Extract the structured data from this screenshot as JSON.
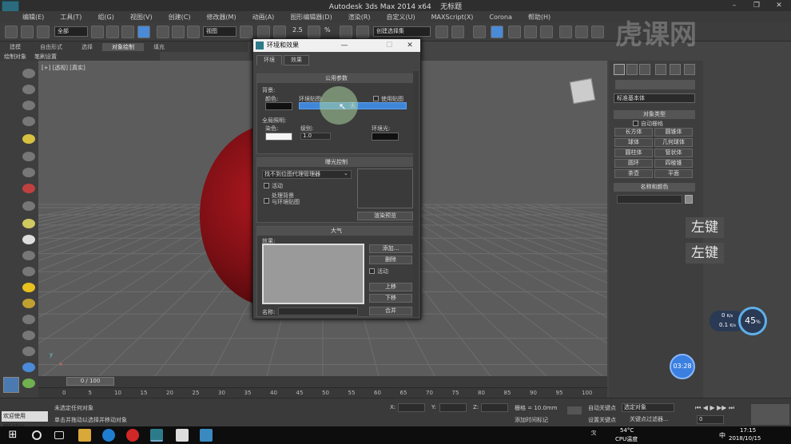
{
  "title_bar": {
    "app": "Autodesk 3ds Max  2014 x64",
    "doc": "无标题",
    "minimize": "–",
    "maximize": "❐",
    "close": "✕"
  },
  "menu": [
    "编辑(E)",
    "工具(T)",
    "组(G)",
    "视图(V)",
    "创建(C)",
    "修改器(M)",
    "动画(A)",
    "图形编辑器(D)",
    "渲染(R)",
    "自定义(U)",
    "MAXScript(X)",
    "Corona",
    "帮助(H)"
  ],
  "toolbar": {
    "selection_filter": "全部",
    "ref_coord": "视图",
    "named_sel": "创建选择集",
    "snap_label": "2.5",
    "percent_label": "%"
  },
  "ribbon": {
    "tabs": [
      "建模",
      "自由形式",
      "选择",
      "对象绘制",
      "填充"
    ],
    "active_tab": "对象绘制",
    "sub": [
      "绘制对象",
      "笔刷设置"
    ]
  },
  "viewport": {
    "label": "[+] [透视] [真实]",
    "axis_x": "x",
    "axis_y": "y",
    "sphere_color": "#8c1218"
  },
  "dialog": {
    "title": "环境和效果",
    "minimize": "—",
    "maximize": "☐",
    "close": "✕",
    "tabs": [
      "环境",
      "效果"
    ],
    "common": {
      "header": "公用参数",
      "bg_group": "背景:",
      "color_label": "颜色:",
      "env_map_label": "环境贴图:",
      "use_map_label": "使用贴图",
      "env_map_btn": "无",
      "global_group": "全局照明:",
      "tint_label": "染色:",
      "level_label": "级别:",
      "level_value": "1.0",
      "ambient_label": "环境光:"
    },
    "exposure": {
      "header": "曝光控制",
      "dropdown": "找不到位图代理管理器",
      "active": "活动",
      "process_bg": "处理背景",
      "and_env": "与环境贴图",
      "render_preview": "渲染预览"
    },
    "atmosphere": {
      "header": "大气",
      "effects_label": "效果:",
      "add": "添加...",
      "delete": "删除",
      "active": "活动",
      "up": "上移",
      "down": "下移",
      "name_label": "名称:",
      "merge": "合并"
    }
  },
  "command_panel": {
    "dropdown": "标准基本体",
    "obj_type_header": "对象类型",
    "auto_grid": "自动栅格",
    "buttons": [
      "长方体",
      "圆锥体",
      "球体",
      "几何球体",
      "圆柱体",
      "管状体",
      "圆环",
      "四棱锥",
      "茶壶",
      "平面"
    ],
    "name_color_header": "名称和颜色"
  },
  "key_hints": [
    "左键",
    "左键"
  ],
  "hud": {
    "upload": "0",
    "upload_unit": "K/s",
    "download": "0.1",
    "download_unit": "K/s",
    "cpu_pct": "45",
    "cpu_unit": "%",
    "timer": "03:28"
  },
  "timeline": {
    "frame": "0 / 100",
    "ticks": [
      "0",
      "5",
      "10",
      "15",
      "20",
      "25",
      "30",
      "35",
      "40",
      "45",
      "50",
      "55",
      "60",
      "65",
      "70",
      "75",
      "80",
      "85",
      "90",
      "95",
      "100"
    ]
  },
  "status": {
    "welcome": "欢迎使用 MAXScr",
    "msg1": "未选定任何对象",
    "msg2": "单击并拖动以选择并移动对象",
    "x_label": "X:",
    "y_label": "Y:",
    "z_label": "Z:",
    "grid": "栅格 = 10.0mm",
    "add_tag": "添加时间标记",
    "auto_key": "自动关键点",
    "set_key": "设置关键点",
    "sel_obj": "选定对象",
    "key_filter": "关键点过滤器...",
    "frame_field": "0"
  },
  "taskbar": {
    "temp": "54°C",
    "cpu_label": "CPU温度",
    "time": "17:15",
    "date": "2018/10/15",
    "lang": "中"
  },
  "watermark": "虎课网"
}
